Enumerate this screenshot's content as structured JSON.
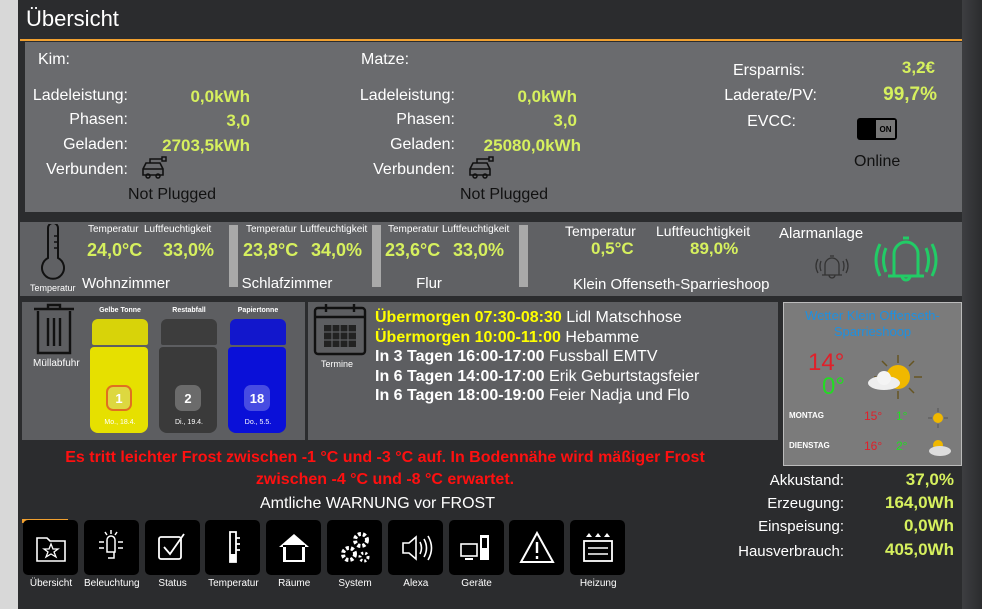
{
  "header": {
    "title": "Übersicht"
  },
  "ev": {
    "kim": {
      "name": "Kim:",
      "ladeleistung_label": "Ladeleistung:",
      "ladeleistung": "0,0kWh",
      "phasen_label": "Phasen:",
      "phasen": "3,0",
      "geladen_label": "Geladen:",
      "geladen": "2703,5kWh",
      "verbunden_label": "Verbunden:",
      "status": "Not Plugged"
    },
    "matze": {
      "name": "Matze:",
      "ladeleistung_label": "Ladeleistung:",
      "ladeleistung": "0,0kWh",
      "phasen_label": "Phasen:",
      "phasen": "3,0",
      "geladen_label": "Geladen:",
      "geladen": "25080,0kWh",
      "verbunden_label": "Verbunden:",
      "status": "Not Plugged"
    },
    "summary": {
      "ersparnis_label": "Ersparnis:",
      "ersparnis": "3,2€",
      "laderate_label": "Laderate/PV:",
      "laderate": "99,7%",
      "evcc_label": "EVCC:",
      "toggle": "ON",
      "evcc_status": "Online"
    }
  },
  "climate": {
    "icon_label": "Temperatur",
    "temp_label": "Temperatur",
    "hum_label": "Luftfeuchtigkeit",
    "rooms": [
      {
        "name": "Wohnzimmer",
        "temp": "24,0°C",
        "hum": "33,0%"
      },
      {
        "name": "Schlafzimmer",
        "temp": "23,8°C",
        "hum": "34,0%"
      },
      {
        "name": "Flur",
        "temp": "23,6°C",
        "hum": "33,0%"
      }
    ],
    "outdoor": {
      "name": "Klein Offenseth-Sparrieshoop",
      "temp": "0,5°C",
      "hum": "89,0%"
    },
    "alarm_label": "Alarmanlage"
  },
  "waste": {
    "label": "Müllabfuhr",
    "bins": [
      {
        "name": "Gelbe Tonne",
        "days": "1",
        "date": "Mo., 18.4."
      },
      {
        "name": "Restabfall",
        "days": "2",
        "date": "Di., 19.4."
      },
      {
        "name": "Papiertonne",
        "days": "18",
        "date": "Do., 5.5."
      }
    ]
  },
  "calendar": {
    "label": "Termine",
    "events": [
      {
        "when": "Übermorgen 07:30-08:30",
        "what": "Lidl Matschhose",
        "highlight": true
      },
      {
        "when": "Übermorgen 10:00-11:00",
        "what": "Hebamme",
        "highlight": true
      },
      {
        "when": "In 3 Tagen 16:00-17:00",
        "what": "Fussball EMTV",
        "highlight": false
      },
      {
        "when": "In 6 Tagen 14:00-17:00",
        "what": "Erik Geburtstagsfeier",
        "highlight": false
      },
      {
        "when": "In 6 Tagen 18:00-19:00",
        "what": "Feier Nadja und Flo",
        "highlight": false
      }
    ]
  },
  "weather": {
    "title": "Wetter Klein Offenseth-Sparrieshoop",
    "high": "14°",
    "low": "0°",
    "days": [
      {
        "day": "MONTAG",
        "high": "15°",
        "low": "1°"
      },
      {
        "day": "DIENSTAG",
        "high": "16°",
        "low": "2°"
      }
    ]
  },
  "warning": {
    "text": "Es tritt leichter Frost zwischen -1 °C und -3 °C auf. In Bodennähe wird mäßiger Frost zwischen -4 °C und -8 °C erwartet.",
    "title": "Amtliche WARNUNG vor FROST"
  },
  "energy": {
    "akku_label": "Akkustand:",
    "akku": "37,0%",
    "erz_label": "Erzeugung:",
    "erz": "164,0Wh",
    "einsp_label": "Einspeisung:",
    "einsp": "0,0Wh",
    "haus_label": "Hausverbrauch:",
    "haus": "405,0Wh"
  },
  "nav": [
    "Übersicht",
    "Beleuchtung",
    "Status",
    "Temperatur",
    "Räume",
    "System",
    "Alexa",
    "Geräte",
    "",
    "Heizung"
  ],
  "colors": {
    "accent": "#f0a030",
    "value": "#d6f05e",
    "alarm_green": "#22cc66",
    "warning": "#ff1010"
  }
}
